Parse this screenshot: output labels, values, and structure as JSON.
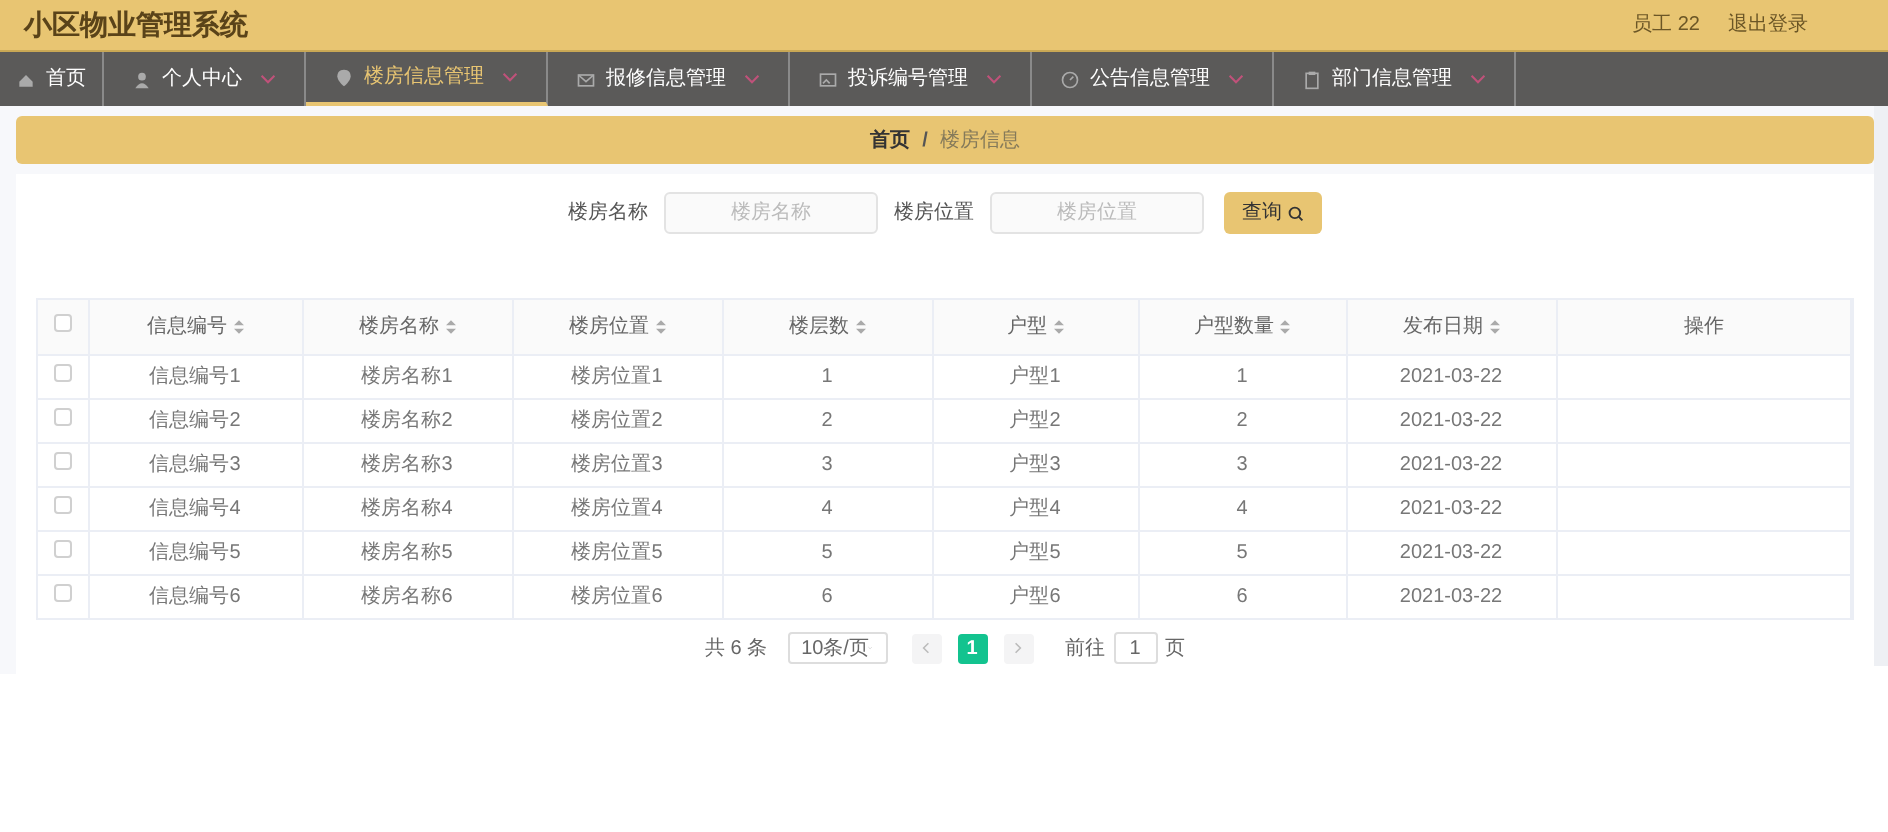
{
  "header": {
    "title": "小区物业管理系统",
    "user": "员工 22",
    "logout": "退出登录"
  },
  "nav": [
    {
      "label": "首页",
      "dropdown": false,
      "selected": false
    },
    {
      "label": "个人中心",
      "dropdown": true,
      "selected": false
    },
    {
      "label": "楼房信息管理",
      "dropdown": true,
      "selected": true
    },
    {
      "label": "报修信息管理",
      "dropdown": true,
      "selected": false
    },
    {
      "label": "投诉编号管理",
      "dropdown": true,
      "selected": false
    },
    {
      "label": "公告信息管理",
      "dropdown": true,
      "selected": false
    },
    {
      "label": "部门信息管理",
      "dropdown": true,
      "selected": false
    }
  ],
  "breadcrumb": {
    "separator": "/",
    "items": [
      "首页",
      "楼房信息"
    ]
  },
  "search": {
    "fields": [
      {
        "label": "楼房名称",
        "placeholder": "楼房名称"
      },
      {
        "label": "楼房位置",
        "placeholder": "楼房位置"
      }
    ],
    "button": "查询"
  },
  "table": {
    "select_all_checked": false,
    "columns": [
      {
        "label": "信息编号",
        "sortable": true
      },
      {
        "label": "楼房名称",
        "sortable": true
      },
      {
        "label": "楼房位置",
        "sortable": true
      },
      {
        "label": "楼层数",
        "sortable": true
      },
      {
        "label": "户型",
        "sortable": true
      },
      {
        "label": "户型数量",
        "sortable": true
      },
      {
        "label": "发布日期",
        "sortable": true
      },
      {
        "label": "操作",
        "sortable": false
      }
    ],
    "rows": [
      {
        "checked": false,
        "cells": [
          "信息编号1",
          "楼房名称1",
          "楼房位置1",
          "1",
          "户型1",
          "1",
          "2021-03-22",
          ""
        ]
      },
      {
        "checked": false,
        "cells": [
          "信息编号2",
          "楼房名称2",
          "楼房位置2",
          "2",
          "户型2",
          "2",
          "2021-03-22",
          ""
        ]
      },
      {
        "checked": false,
        "cells": [
          "信息编号3",
          "楼房名称3",
          "楼房位置3",
          "3",
          "户型3",
          "3",
          "2021-03-22",
          ""
        ]
      },
      {
        "checked": false,
        "cells": [
          "信息编号4",
          "楼房名称4",
          "楼房位置4",
          "4",
          "户型4",
          "4",
          "2021-03-22",
          ""
        ]
      },
      {
        "checked": false,
        "cells": [
          "信息编号5",
          "楼房名称5",
          "楼房位置5",
          "5",
          "户型5",
          "5",
          "2021-03-22",
          ""
        ]
      },
      {
        "checked": false,
        "cells": [
          "信息编号6",
          "楼房名称6",
          "楼房位置6",
          "6",
          "户型6",
          "6",
          "2021-03-22",
          ""
        ]
      }
    ]
  },
  "pagination": {
    "total": "共 6 条",
    "page_size": "10条/页",
    "pages": [
      {
        "label": "1",
        "selected": true
      }
    ],
    "goto_label": "前往",
    "goto_value": "1",
    "goto_suffix": "页"
  }
}
